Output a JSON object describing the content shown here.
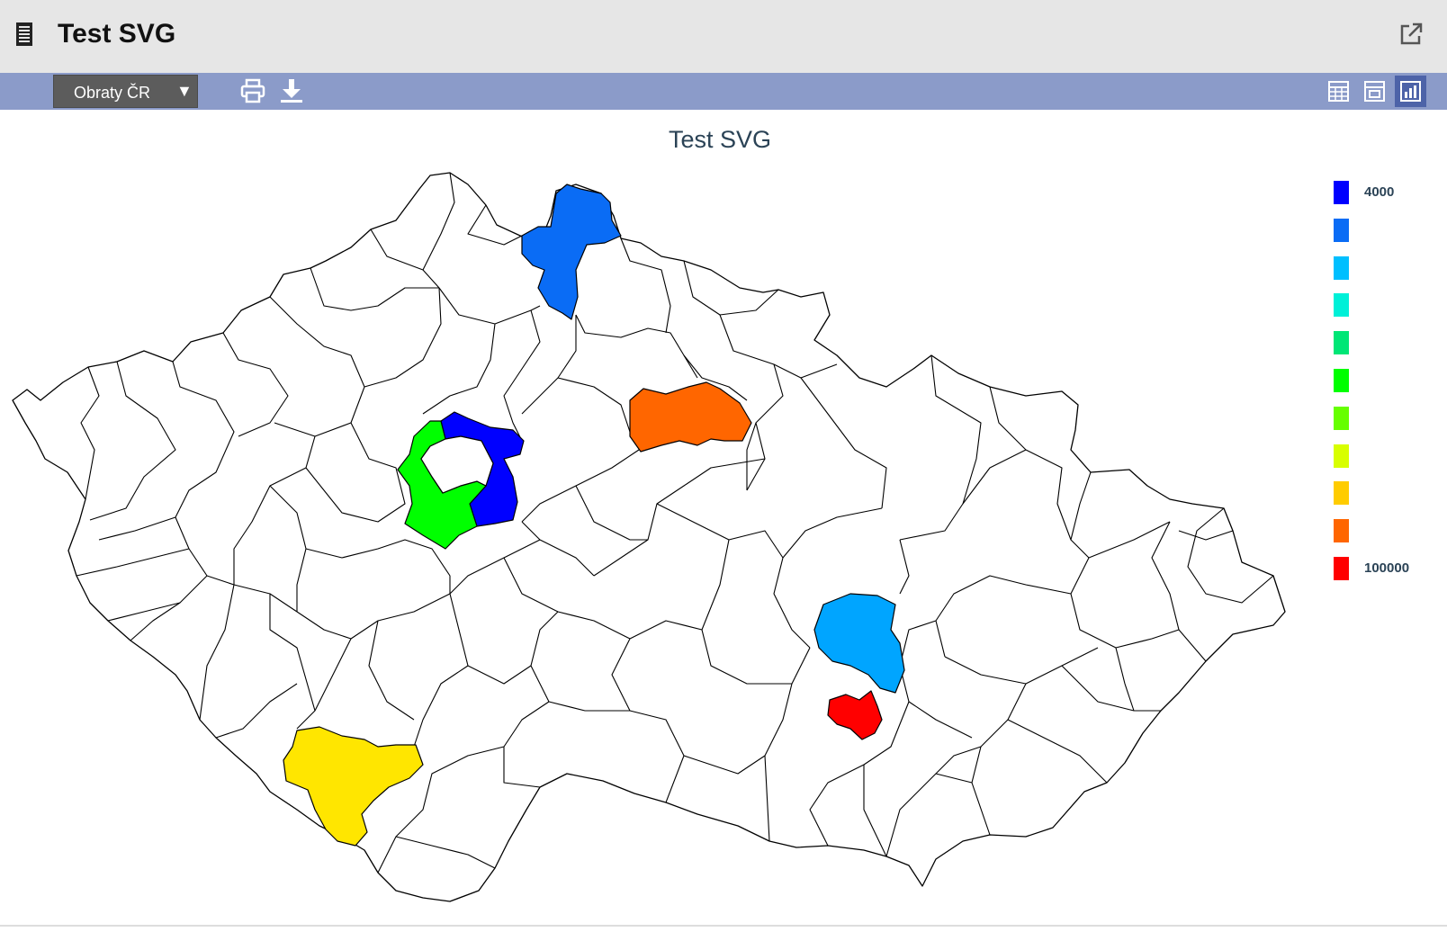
{
  "header": {
    "title": "Test SVG"
  },
  "toolbar": {
    "dropdown_value": "Obraty ČR",
    "views": [
      "table-view",
      "layout-view",
      "chart-view"
    ],
    "active_view": "chart-view"
  },
  "chart": {
    "title": "Test SVG",
    "legend": {
      "min_label": "4000",
      "max_label": "100000",
      "colors": [
        "#0000ff",
        "#0a6cf5",
        "#00bfff",
        "#00f0d8",
        "#00e676",
        "#00ff00",
        "#66ff00",
        "#d8ff00",
        "#ffcc00",
        "#ff6600",
        "#ff0000"
      ]
    }
  },
  "chart_data": {
    "type": "choropleth",
    "title": "Test SVG",
    "region_set": "Czech Republic districts",
    "highlighted_regions": [
      {
        "fill": "#0000ff"
      },
      {
        "fill": "#0a6cf5"
      },
      {
        "fill": "#00a5ff"
      },
      {
        "fill": "#00ff00"
      },
      {
        "fill": "#ffe600"
      },
      {
        "fill": "#ff6600"
      },
      {
        "fill": "#ff0000"
      }
    ],
    "scale_min": 4000,
    "scale_max": 100000,
    "legend_placement": "right"
  }
}
